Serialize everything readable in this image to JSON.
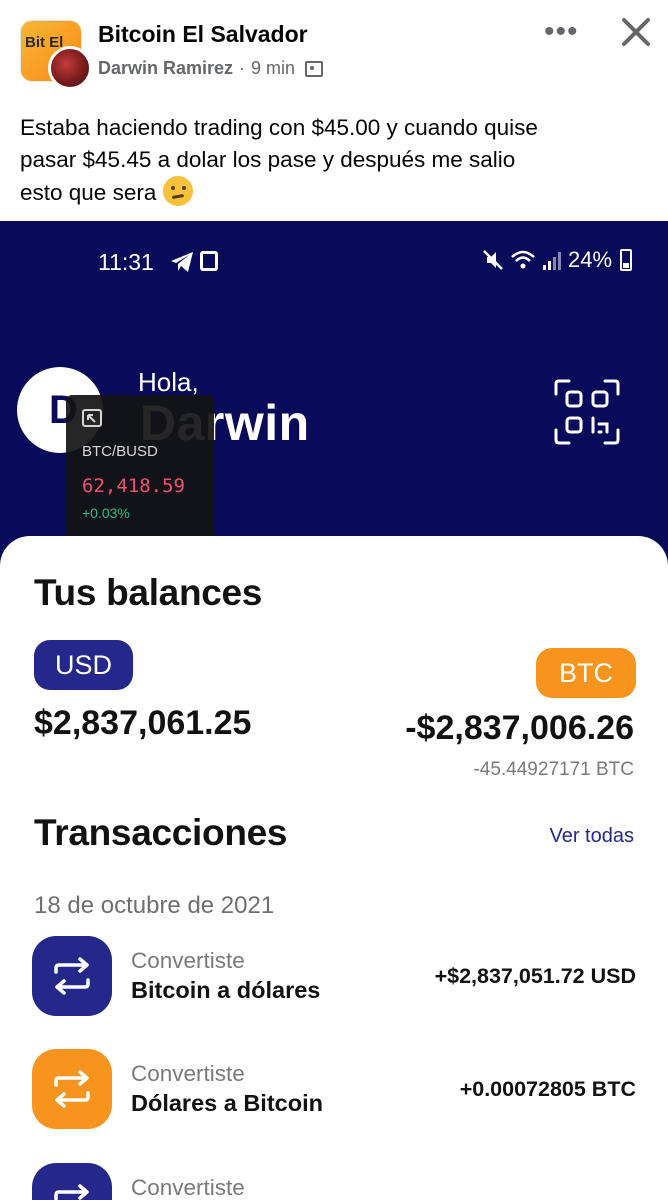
{
  "post": {
    "group_name": "Bitcoin El Salvador",
    "group_logo_text": "Bit El",
    "author": "Darwin Ramirez",
    "separator": "·",
    "time": "9 min",
    "more_icon": "more-horizontal-icon",
    "close_icon": "close-icon",
    "text_line1": "Estaba haciendo trading con $45.00 y cuando quise",
    "text_line2": "pasar $45.45 a dolar  los pase y después me salio",
    "text_line3": "esto que sera",
    "emoji": "thinking-face-icon"
  },
  "phone": {
    "status": {
      "time": "11:31",
      "battery": "24%"
    },
    "greeting": "Hola,",
    "name": "Darwin",
    "avatar_initial": "D",
    "ticker": {
      "pair": "BTC/BUSD",
      "price": "62,418.59",
      "change": "+0.03%"
    },
    "balances": {
      "title": "Tus balances",
      "usd_label": "USD",
      "usd_amount": "$2,837,061.25",
      "btc_label": "BTC",
      "btc_amount": "-$2,837,006.26",
      "btc_sub": "-45.44927171 BTC"
    },
    "transactions": {
      "title": "Transacciones",
      "see_all": "Ver todas",
      "date": "18 de octubre de 2021",
      "items": [
        {
          "kind": "Convertiste",
          "desc": "Bitcoin a dólares",
          "amount": "+$2,837,051.72 USD",
          "color": "#25278a"
        },
        {
          "kind": "Convertiste",
          "desc": "Dólares a Bitcoin",
          "amount": "+0.00072805 BTC",
          "color": "#f7941d"
        },
        {
          "kind": "Convertiste",
          "desc": "",
          "amount": "",
          "color": "#25278a"
        }
      ]
    }
  },
  "colors": {
    "navy": "#0a0a5a",
    "brand_blue": "#25278a",
    "brand_orange": "#f7941d",
    "ticker_red": "#f0506e",
    "ticker_green": "#2ebd85"
  }
}
